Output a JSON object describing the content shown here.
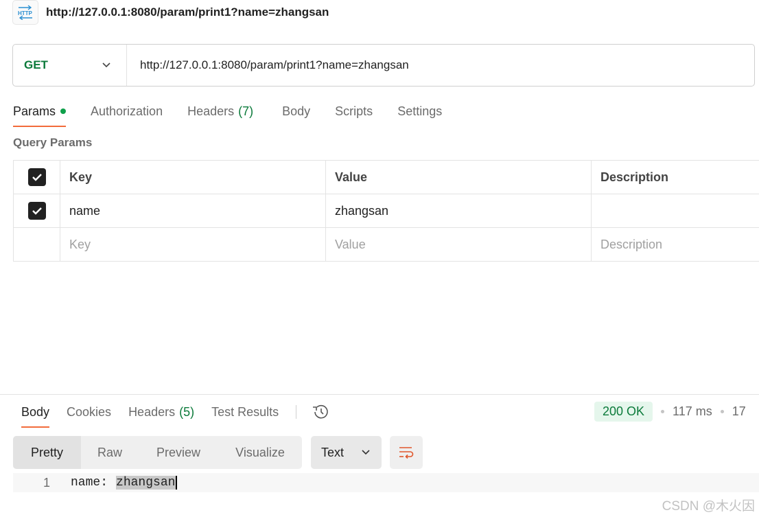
{
  "request": {
    "title": "http://127.0.0.1:8080/param/print1?name=zhangsan",
    "method": "GET",
    "url": "http://127.0.0.1:8080/param/print1?name=zhangsan"
  },
  "request_tabs": {
    "params": "Params",
    "authorization": "Authorization",
    "headers": "Headers",
    "headers_count": "(7)",
    "body": "Body",
    "scripts": "Scripts",
    "settings": "Settings"
  },
  "query_params": {
    "label": "Query Params",
    "columns": {
      "key": "Key",
      "value": "Value",
      "description": "Description"
    },
    "rows": [
      {
        "checked": true,
        "key": "name",
        "value": "zhangsan",
        "description": ""
      }
    ],
    "placeholder": {
      "key": "Key",
      "value": "Value",
      "description": "Description"
    }
  },
  "response_tabs": {
    "body": "Body",
    "cookies": "Cookies",
    "headers": "Headers",
    "headers_count": "(5)",
    "test_results": "Test Results"
  },
  "response_meta": {
    "status": "200 OK",
    "time": "117 ms",
    "size": "17"
  },
  "format": {
    "pretty": "Pretty",
    "raw": "Raw",
    "preview": "Preview",
    "visualize": "Visualize",
    "type": "Text"
  },
  "response_body": {
    "line_number": "1",
    "key": "name:",
    "value": "zhangsan"
  },
  "watermark": "CSDN @木火因",
  "colors": {
    "accent": "#f26b3a",
    "method_green": "#0b7a3a",
    "status_bg": "#e5f6ec"
  },
  "icons": {
    "http": "http-icon",
    "chevron": "chevron-down-icon",
    "history": "history-icon",
    "wrap": "wrap-lines-icon",
    "check": "check-icon"
  }
}
